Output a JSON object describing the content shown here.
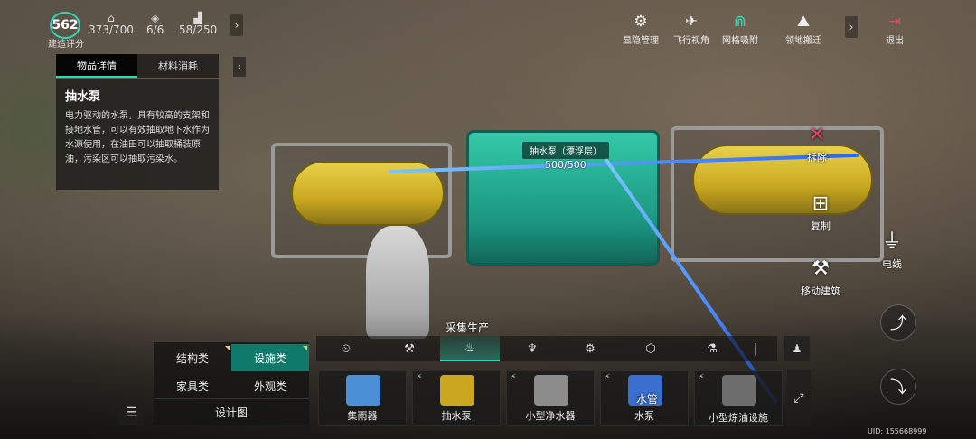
{
  "hud": {
    "build_score": {
      "value": "562",
      "label": "建造评分"
    },
    "stats": [
      {
        "icon": "building-icon",
        "glyph": "⌂",
        "value": "373/700"
      },
      {
        "icon": "tag-icon",
        "glyph": "◈",
        "value": "6/6"
      },
      {
        "icon": "factory-icon",
        "glyph": "▟",
        "value": "58/250"
      }
    ],
    "expand_arrow": "›",
    "toolbar": [
      {
        "id": "visibility",
        "icon": "gear-icon",
        "glyph": "⚙",
        "label": "显隐管理"
      },
      {
        "id": "flight",
        "icon": "drone-icon",
        "glyph": "✈",
        "label": "飞行视角"
      },
      {
        "id": "grid-snap",
        "icon": "magnet-icon",
        "glyph": "⋒",
        "label": "网格吸附"
      },
      {
        "id": "relocate",
        "icon": "relocate-icon",
        "glyph": "⛰",
        "label": "领地搬迁"
      }
    ],
    "toolbar_arrow": "›",
    "exit": {
      "icon": "exit-icon",
      "glyph": "⇥",
      "label": "退出"
    }
  },
  "info_panel": {
    "tabs": [
      "物品详情",
      "材料消耗"
    ],
    "active_tab": 0,
    "title": "抽水泵",
    "description": "电力驱动的水泵，具有较高的支架和接地水管，可以有效抽取地下水作为水源使用，在油田可以抽取桶装原油，污染区可以抽取污染水。",
    "collapse_arrow": "‹"
  },
  "world": {
    "selected_label": "抽水泵（漂浮层）",
    "durability": "500/500"
  },
  "right_actions": {
    "demolish": {
      "icon": "demolish-icon",
      "glyph": "✕",
      "label": "拆除"
    },
    "copy": {
      "icon": "copy-icon",
      "glyph": "⊞",
      "label": "复制"
    },
    "wire": {
      "icon": "plug-icon",
      "glyph": "⏚",
      "label": "电线"
    },
    "move": {
      "icon": "hammer-icon",
      "glyph": "⚒",
      "label": "移动建筑"
    },
    "pose_1": {
      "icon": "jump-icon",
      "glyph": "⤴"
    },
    "pose_2": {
      "icon": "crouch-icon",
      "glyph": "⤵"
    }
  },
  "build_menu": {
    "categories": [
      {
        "label": "结构类",
        "active": false
      },
      {
        "label": "设施类",
        "active": true
      },
      {
        "label": "家具类",
        "active": false
      },
      {
        "label": "外观类",
        "active": false
      }
    ],
    "blueprint": "设计图",
    "filter_glyph": "☰",
    "sub_category_title": "采集生产",
    "sub_tabs": [
      {
        "icon": "clock-icon",
        "glyph": "⏲"
      },
      {
        "icon": "tools-icon",
        "glyph": "⚒"
      },
      {
        "icon": "harvest-icon",
        "glyph": "♨",
        "active": true
      },
      {
        "icon": "cook-icon",
        "glyph": "♆"
      },
      {
        "icon": "motorbike-icon",
        "glyph": "⚙"
      },
      {
        "icon": "box-icon",
        "glyph": "⬡"
      },
      {
        "icon": "machine-icon",
        "glyph": "⚗"
      },
      {
        "icon": "more-icon",
        "glyph": "|"
      }
    ],
    "sub_extra_glyph": "♟",
    "items": [
      {
        "label": "集雨器",
        "color": "#4b8fd6",
        "powered": false
      },
      {
        "label": "抽水泵",
        "color": "#c9a820",
        "powered": true
      },
      {
        "label": "小型净水器",
        "color": "#8c8c8c",
        "powered": true
      },
      {
        "label": "水泵",
        "color": "#3a6fd0",
        "powered": true
      },
      {
        "label": "小型炼油设施",
        "color": "#6d6d6d",
        "powered": true
      }
    ],
    "item_tooltip": "水管",
    "expand_glyph": "⤢"
  },
  "uid": "UID: 155668999",
  "colors": {
    "accent": "#2fd8b6",
    "active_tab": "#0f7a6a",
    "exit": "#e0476a",
    "marker": "#e8d34a"
  }
}
